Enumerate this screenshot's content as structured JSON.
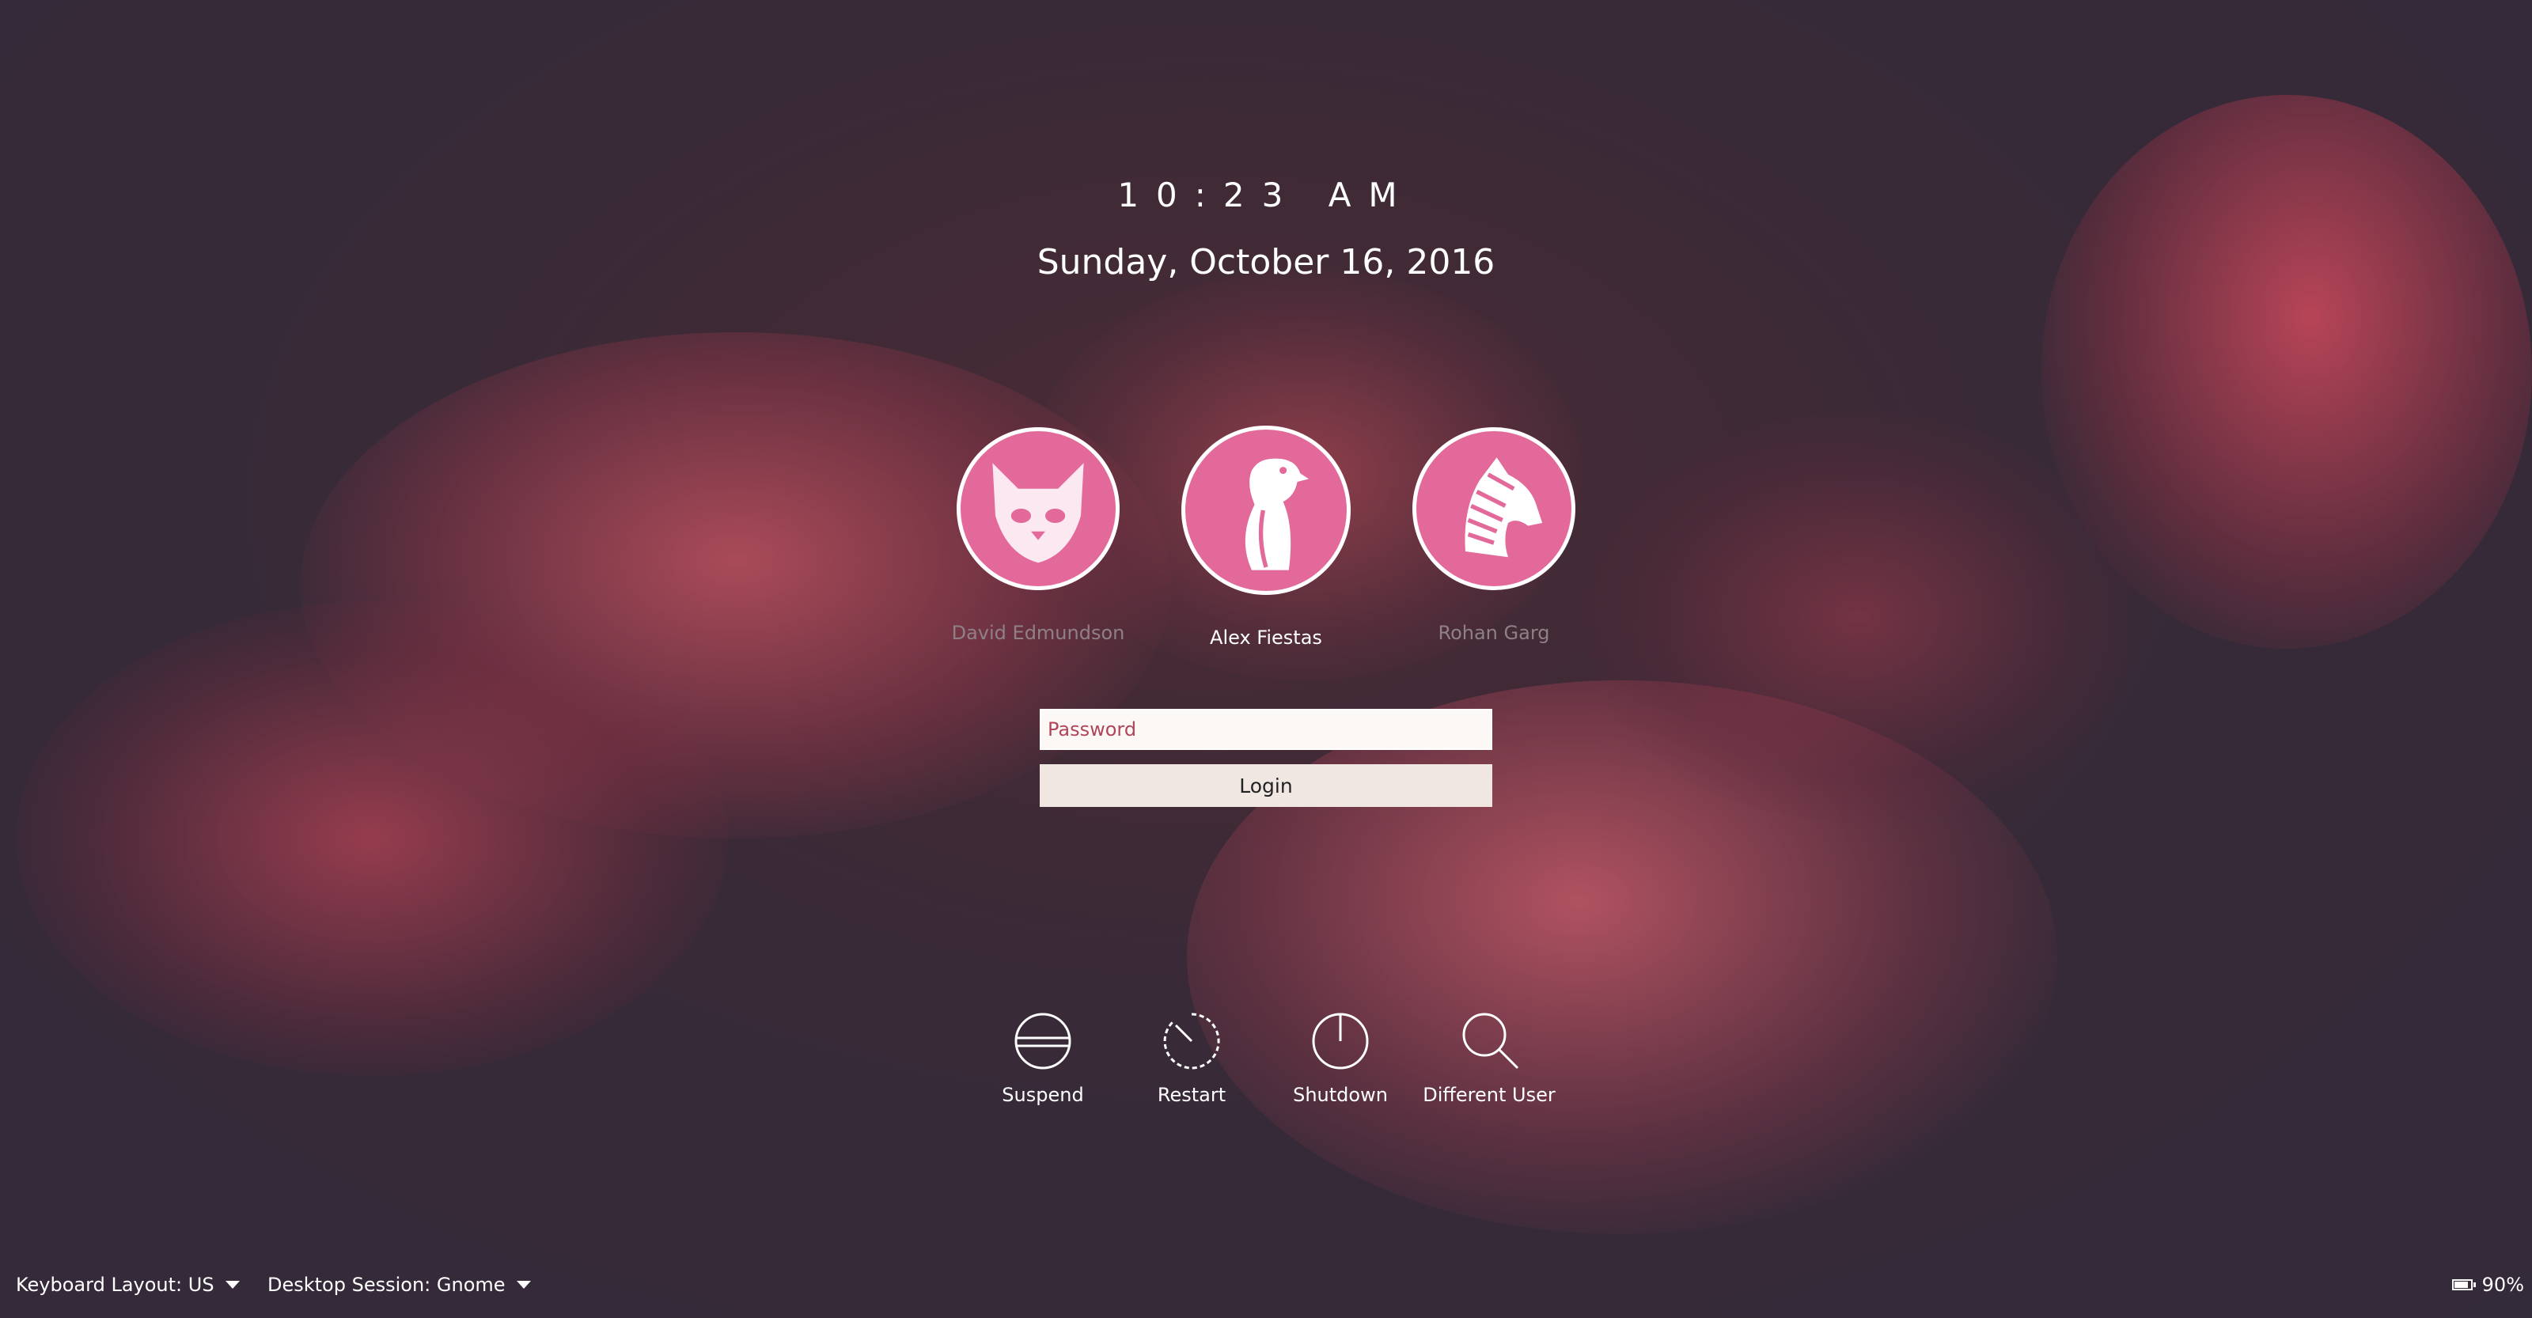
{
  "clock": {
    "time": "10:23 AM",
    "date": "Sunday, October 16, 2016"
  },
  "users": [
    {
      "name": "David Edmundson",
      "avatar_icon": "cat-icon",
      "current": false
    },
    {
      "name": "Alex Fiestas",
      "avatar_icon": "penguin-icon",
      "current": true
    },
    {
      "name": "Rohan Garg",
      "avatar_icon": "zebra-icon",
      "current": false
    }
  ],
  "login": {
    "password_placeholder": "Password",
    "login_label": "Login"
  },
  "actions": {
    "suspend": {
      "label": "Suspend",
      "icon": "suspend-icon"
    },
    "restart": {
      "label": "Restart",
      "icon": "restart-icon"
    },
    "shutdown": {
      "label": "Shutdown",
      "icon": "shutdown-icon"
    },
    "different_user": {
      "label": "Different User",
      "icon": "search-icon"
    }
  },
  "bottom_bar": {
    "keyboard_layout": "Keyboard Layout: US",
    "desktop_session": "Desktop Session: Gnome",
    "battery": "90%"
  },
  "colors": {
    "background": "#352a38",
    "avatar_fill": "#e3699b",
    "accent_pink": "#e0445e"
  }
}
